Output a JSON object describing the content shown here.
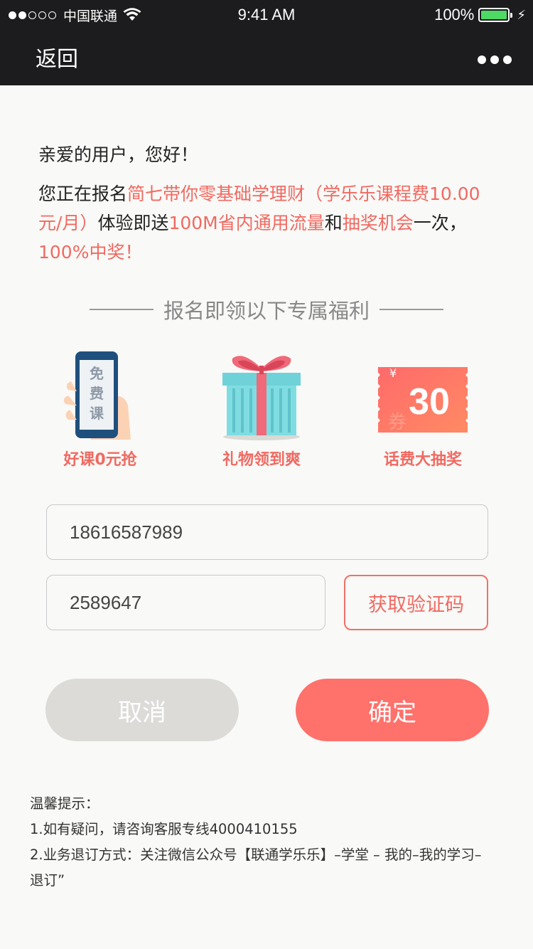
{
  "status_bar": {
    "carrier": "中国联通",
    "time": "9:41 AM",
    "battery": "100%"
  },
  "nav": {
    "back_label": "返回"
  },
  "greeting": "亲爱的用户，您好！",
  "intro": {
    "p1": "您正在报名",
    "p2": "简七带你零基础学理财（学乐乐课程费10.00元/月）",
    "p3": "体验即送",
    "p4": "100M省内通用流量",
    "p5": "和",
    "p6": "抽奖机会",
    "p7": "一次，",
    "p8": "100%中奖！"
  },
  "section_title": "报名即领以下专属福利",
  "benefits": [
    {
      "label": "好课0元抢",
      "phone_text": [
        "免",
        "费",
        "课"
      ]
    },
    {
      "label": "礼物领到爽"
    },
    {
      "label": "话费大抽奖",
      "coupon_value": "30",
      "coupon_symbol": "¥",
      "coupon_char": "券"
    }
  ],
  "form": {
    "phone_value": "18616587989",
    "code_value": "2589647",
    "get_code_label": "获取验证码"
  },
  "buttons": {
    "cancel": "取消",
    "confirm": "确定"
  },
  "tips": {
    "title": "温馨提示：",
    "line1": "1.如有疑问，请咨询客服专线4000410155",
    "line2": "2.业务退订方式：关注微信公众号【联通学乐乐】–学堂 – 我的–我的学习–退订”"
  },
  "colors": {
    "accent": "#f06a62",
    "nav_bg": "#1c1c1f",
    "confirm_bg": "#ff716b",
    "cancel_bg": "#dcdbd8",
    "battery": "#4cd964"
  }
}
